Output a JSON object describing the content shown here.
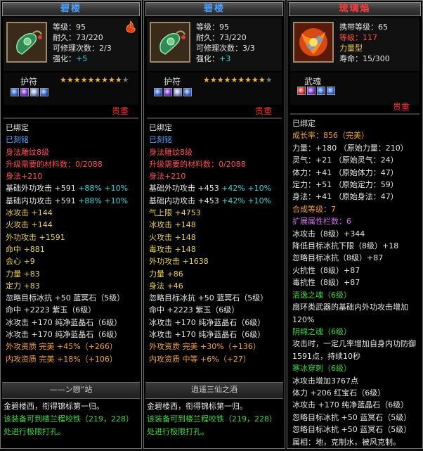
{
  "panels": [
    {
      "title": "碧楼",
      "level": "等级：95",
      "durability": "耐久：73/220",
      "repair": "可修理次数：2/3",
      "enhance_label": "强化：",
      "enhance_value": "+5",
      "type_label": "护符",
      "stars_gold": "★★★★★★★★★",
      "stars_gray": "★",
      "price": "贵重",
      "lines": [
        {
          "t": "已绑定",
          "c": "w"
        },
        {
          "t": "已刻铭",
          "c": "b"
        },
        {
          "t": "身法雕纹8级",
          "c": "r"
        },
        {
          "t": "升级需要的材料数：0/2088",
          "c": "r"
        },
        {
          "t": "身法+210",
          "c": "r"
        },
        {
          "t": "基础外功攻击 +591",
          "c": "w",
          "ext": [
            {
              "t": " +88%",
              "c": "c"
            },
            {
              "t": " +10%",
              "c": "c"
            }
          ]
        },
        {
          "t": "基础内功攻击 +591",
          "c": "w",
          "ext": [
            {
              "t": " +88%",
              "c": "c"
            },
            {
              "t": " +10%",
              "c": "c"
            }
          ]
        },
        {
          "t": "冰攻击 +144",
          "c": "y"
        },
        {
          "t": "火攻击 +144",
          "c": "y"
        },
        {
          "t": "外功攻击 +1591",
          "c": "y"
        },
        {
          "t": "命中 +881",
          "c": "y"
        },
        {
          "t": "会心 +9",
          "c": "y"
        },
        {
          "t": "力量 +83",
          "c": "y"
        },
        {
          "t": "定力 +83",
          "c": "y"
        },
        {
          "t": "忽略目标冰抗 +50 蓝冥石（5级）",
          "c": "w"
        },
        {
          "t": "命中 +2223 紫玉（6级）",
          "c": "w"
        },
        {
          "t": "冰攻击 +170 纯净蓝晶石（6级）",
          "c": "w"
        },
        {
          "t": "冰攻击 +170 纯净蓝晶石（6级）",
          "c": "w"
        },
        {
          "t": "外攻资质  完美 +45%（+266）",
          "c": "o"
        },
        {
          "t": "内攻资质  完美 +18%（+106）",
          "c": "o"
        }
      ],
      "signature": "——ン戀“站",
      "footer_1": "金碧楼西，衔得锦标第一归。",
      "footer_2": "该装备可到楼兰程咬铁（219，228）处进行极限打孔。"
    },
    {
      "title": "碧楼",
      "level": "等级：95",
      "durability": "耐久：73/220",
      "repair": "可修理次数：3/3",
      "enhance_label": "强化：",
      "enhance_value": "+3",
      "type_label": "护符",
      "stars_gold": "★★★★★★★★★",
      "stars_gray": "★",
      "price": "贵重",
      "lines": [
        {
          "t": "已绑定",
          "c": "w"
        },
        {
          "t": "已刻铭",
          "c": "b"
        },
        {
          "t": "身法雕纹8级",
          "c": "r"
        },
        {
          "t": "升级需要的材料数：0/2088",
          "c": "r"
        },
        {
          "t": "身法+210",
          "c": "r"
        },
        {
          "t": "基础外功攻击 +453",
          "c": "w",
          "ext": [
            {
              "t": " +42%",
              "c": "c"
            },
            {
              "t": " +10%",
              "c": "c"
            }
          ]
        },
        {
          "t": "基础内功攻击 +453",
          "c": "w",
          "ext": [
            {
              "t": " +42%",
              "c": "c"
            },
            {
              "t": " +10%",
              "c": "c"
            }
          ]
        },
        {
          "t": "气上限 +4753",
          "c": "y"
        },
        {
          "t": "冰攻击 +148",
          "c": "y"
        },
        {
          "t": "火攻击 +148",
          "c": "y"
        },
        {
          "t": "毒攻击 +148",
          "c": "y"
        },
        {
          "t": "外功攻击 +1638",
          "c": "y"
        },
        {
          "t": "力量 +86",
          "c": "y"
        },
        {
          "t": "身法 +46",
          "c": "y"
        },
        {
          "t": "忽略目标冰抗 +50 蓝冥石（5级）",
          "c": "w"
        },
        {
          "t": "命中 +2223 紫玉（6级）",
          "c": "w"
        },
        {
          "t": "冰攻击 +170 纯净蓝晶石（6级）",
          "c": "w"
        },
        {
          "t": "冰攻击 +170 纯净蓝晶石（6级）",
          "c": "w"
        },
        {
          "t": "外攻资质  完美 +30%（+136）",
          "c": "o"
        },
        {
          "t": "内攻资质  中等 +6%（+27）",
          "c": "o"
        }
      ],
      "signature": "逍遥三仙之酒",
      "footer_1": "金碧楼西，衔得锦标第一归。",
      "footer_2": "该装备可到楼兰程咬铁（219，228）处进行极限打孔。"
    }
  ],
  "pet": {
    "title": "琉璃焰",
    "carry_level": "携带等级：65",
    "level": "等级：117",
    "type": "力量型",
    "lifespan": "寿命：15/300",
    "soul_label": "武魂",
    "price": "贵重",
    "lines": [
      {
        "t": "已绑定",
        "c": "w"
      },
      {
        "t": "成长率：856（完美）",
        "c": "o"
      },
      {
        "t": "力量：+180 （原始力量：210）",
        "c": "w"
      },
      {
        "t": "灵气：+21 （原始灵气：24）",
        "c": "w"
      },
      {
        "t": "体力：+41 （原始体力：47）",
        "c": "w"
      },
      {
        "t": "定力：+51 （原始定力：59）",
        "c": "w"
      },
      {
        "t": "身法：+41 （原始身法：47）",
        "c": "w"
      },
      {
        "t": "合成等级：7",
        "c": "o"
      },
      {
        "t": "扩展属性栏数：6",
        "c": "m"
      },
      {
        "t": "冰攻击（8级）+344",
        "c": "w"
      },
      {
        "t": "降低目标冰抗下限（8级）+18",
        "c": "w"
      },
      {
        "t": "忽略目标冰抗（8级）+87",
        "c": "w"
      },
      {
        "t": "火抗性（8级）+87",
        "c": "w"
      },
      {
        "t": "毒抗性（8级）+87",
        "c": "w"
      },
      {
        "t": "清逸之魂（6级）",
        "c": "g"
      },
      {
        "t": "扇环类武器的基础内外功攻击增加120%",
        "c": "w",
        "wrap": true
      },
      {
        "t": "阴绵之魂（6级）",
        "c": "g"
      },
      {
        "t": "攻击时，一定几率增加自身内功防御1591点，持续10秒",
        "c": "w",
        "wrap": true
      },
      {
        "t": "寒冰穿刺（6级）",
        "c": "g"
      },
      {
        "t": "冰攻击增加3767点",
        "c": "w"
      },
      {
        "t": "体力 +206 红宝石（6级）",
        "c": "w"
      },
      {
        "t": "冰攻击 +170 纯净蓝晶石（6级）",
        "c": "w"
      },
      {
        "t": "忽略目标冰抗 +50 蓝冥石（5级）",
        "c": "w"
      },
      {
        "t": "忽略目标冰抗 +50 蓝冥石（5级）",
        "c": "w"
      },
      {
        "t": "属相：地，克制水，被风克制。",
        "c": "w"
      }
    ]
  }
}
